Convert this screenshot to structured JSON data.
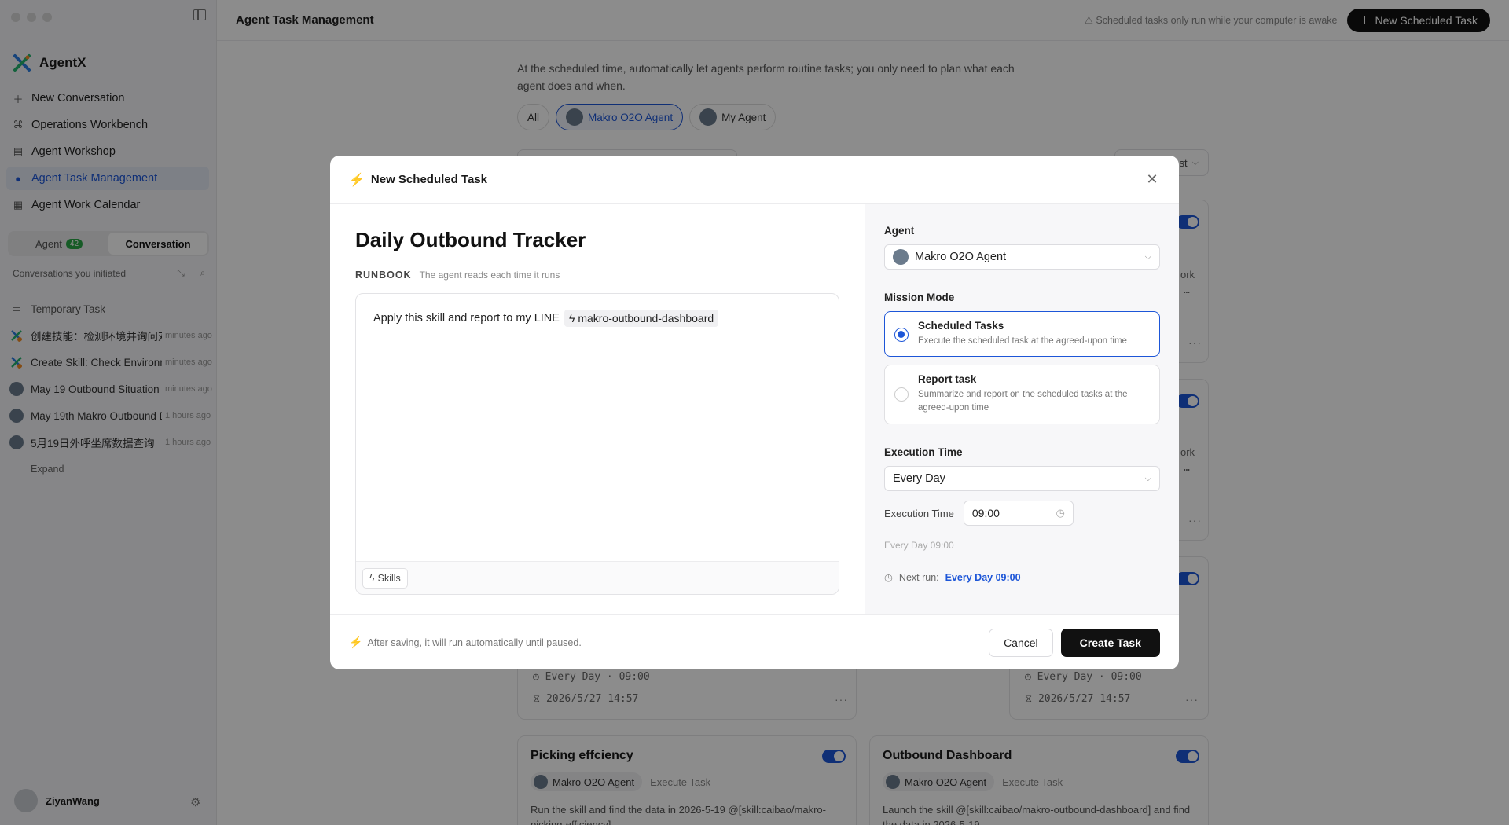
{
  "sidebar": {
    "brand": "AgentX",
    "nav": [
      {
        "label": "New Conversation",
        "icon": "plus-icon"
      },
      {
        "label": "Operations Workbench",
        "icon": "workbench-icon"
      },
      {
        "label": "Agent Workshop",
        "icon": "workshop-icon"
      },
      {
        "label": "Agent Task Management",
        "icon": "clock-icon"
      },
      {
        "label": "Agent Work Calendar",
        "icon": "calendar-icon"
      }
    ],
    "tabs": {
      "agent": "Agent",
      "agent_count": "42",
      "conversation": "Conversation"
    },
    "conv_header": "Conversations you initiated",
    "conversations": [
      {
        "title": "Temporary Task",
        "time": ""
      },
      {
        "title": "创建技能：检测环境并询问对",
        "time": "minutes ago"
      },
      {
        "title": "Create Skill: Check Environm",
        "time": "minutes ago"
      },
      {
        "title": "May 19 Outbound Situation (",
        "time": "minutes ago"
      },
      {
        "title": "May 19th Makro Outbound D",
        "time": "1 hours ago"
      },
      {
        "title": "5月19日外呼坐席数据查询",
        "time": "1 hours ago"
      }
    ],
    "expand": "Expand",
    "user": "ZiyanWang"
  },
  "header": {
    "title": "Agent Task Management",
    "hint": "Scheduled tasks only run while your computer is awake",
    "new_button": "New Scheduled Task"
  },
  "main": {
    "description": "At the scheduled time, automatically let agents perform routine tasks; you only need to plan what each agent does and when.",
    "filters": [
      "All",
      "Makro O2O Agent",
      "My Agent"
    ],
    "sort_label": "st",
    "cards_partial": {
      "schedule": "Every Day · 09:00",
      "date": "2026/5/27 14:57",
      "side_fragment_1": "ork",
      "side_fragment_2": "…"
    },
    "cards_bottom": [
      {
        "title": "Picking effciency",
        "agent": "Makro O2O Agent",
        "type": "Execute Task",
        "body": "Run the skill and find the data in 2026-5-19 @[skill:caibao/makro-picking-efficiency]"
      },
      {
        "title": "Outbound Dashboard",
        "agent": "Makro O2O Agent",
        "type": "Execute Task",
        "body": "Launch the skill @[skill:caibao/makro-outbound-dashboard] and find the data in 2026-5-19"
      }
    ]
  },
  "modal": {
    "title": "New Scheduled Task",
    "task_name": "Daily Outbound Tracker",
    "runbook_label": "RUNBOOK",
    "runbook_sub": "The agent reads each time it runs",
    "runbook_text": "Apply this skill and report to my LINE",
    "skill_tag": "makro-outbound-dashboard",
    "skills_button": "Skills",
    "agent_label": "Agent",
    "agent_value": "Makro O2O Agent",
    "mode_label": "Mission Mode",
    "modes": [
      {
        "title": "Scheduled Tasks",
        "desc": "Execute the scheduled task at the agreed-upon time",
        "selected": true
      },
      {
        "title": "Report task",
        "desc": "Summarize and report on the scheduled tasks at the agreed-upon time",
        "selected": false
      }
    ],
    "exec_label": "Execution Time",
    "frequency": "Every Day",
    "time_label": "Execution Time",
    "time_value": "09:00",
    "summary": "Every Day 09:00",
    "next_run_label": "Next run:",
    "next_run_value": "Every Day 09:00",
    "footer_note": "After saving, it will run automatically until paused.",
    "cancel": "Cancel",
    "create": "Create Task"
  }
}
